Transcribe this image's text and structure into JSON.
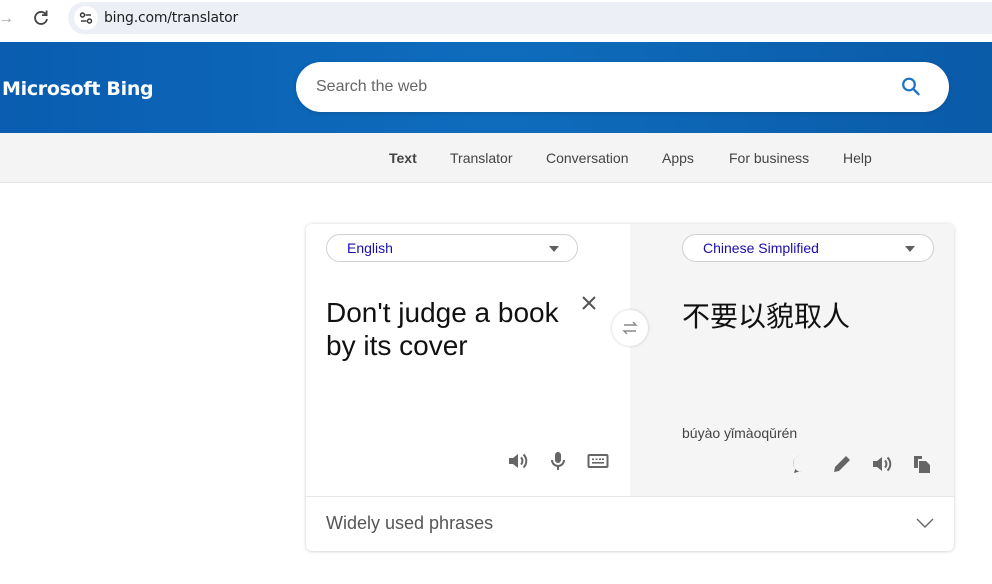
{
  "browser": {
    "url": "bing.com/translator"
  },
  "header": {
    "logo": "Microsoft Bing",
    "search_placeholder": "Search the web"
  },
  "subnav": {
    "items": [
      {
        "label": "Text",
        "active": true
      },
      {
        "label": "Translator",
        "active": false
      },
      {
        "label": "Conversation",
        "active": false
      },
      {
        "label": "Apps",
        "active": false
      },
      {
        "label": "For business",
        "active": false
      },
      {
        "label": "Help",
        "active": false
      }
    ]
  },
  "translator": {
    "source_language": "English",
    "target_language": "Chinese Simplified",
    "source_text": "Don't judge a book by its cover",
    "target_text": "不要以貌取人",
    "transliteration": "búyào yǐmàoqǔrén",
    "source_icons": [
      "speaker-icon",
      "microphone-icon",
      "keyboard-icon"
    ],
    "target_icons": [
      "comment-icon",
      "pencil-icon",
      "speaker-icon",
      "copy-icon"
    ]
  },
  "phrases": {
    "label": "Widely used phrases"
  },
  "colors": {
    "brand_blue": "#0f6cbd",
    "language_link": "#1a0dab",
    "target_pane_bg": "#f5f5f5"
  }
}
